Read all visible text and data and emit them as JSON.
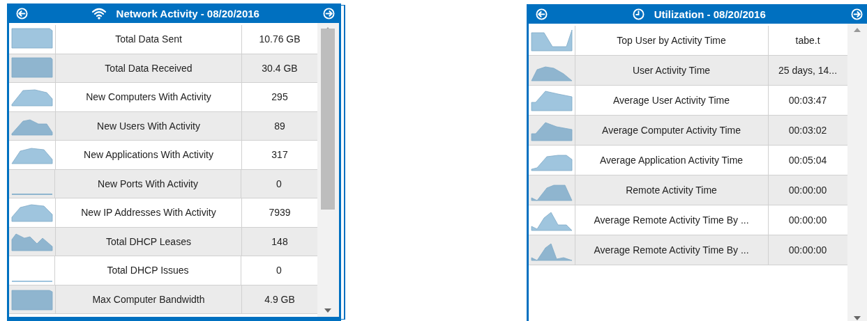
{
  "panels": [
    {
      "title": "Network Activity - 08/20/2016",
      "rows": [
        {
          "label": "Total Data Sent",
          "value": "10.76 GB"
        },
        {
          "label": "Total Data Received",
          "value": "30.4 GB"
        },
        {
          "label": "New Computers With Activity",
          "value": "295"
        },
        {
          "label": "New Users With Activity",
          "value": "89"
        },
        {
          "label": "New Applications With Activity",
          "value": "317"
        },
        {
          "label": "New Ports With Activity",
          "value": "0"
        },
        {
          "label": "New IP Addresses With Activity",
          "value": "7939"
        },
        {
          "label": "Total DHCP Leases",
          "value": "148"
        },
        {
          "label": "Total DHCP Issues",
          "value": "0"
        },
        {
          "label": "Max Computer Bandwidth",
          "value": "4.9 GB"
        }
      ]
    },
    {
      "title": "Utilization - 08/20/2016",
      "rows": [
        {
          "label": "Top User by Activity Time",
          "value": "tabe.t"
        },
        {
          "label": "User Activity Time",
          "value": "25 days, 14..."
        },
        {
          "label": "Average User Activity Time",
          "value": "00:03:47"
        },
        {
          "label": "Average Computer Activity Time",
          "value": "00:03:02"
        },
        {
          "label": "Average Application Activity Time",
          "value": "00:05:04"
        },
        {
          "label": "Remote Activity Time",
          "value": "00:00:00"
        },
        {
          "label": "Average Remote Activity Time By ...",
          "value": "00:00:00"
        },
        {
          "label": "Average Remote Activity Time By ...",
          "value": "00:00:00"
        }
      ]
    }
  ]
}
